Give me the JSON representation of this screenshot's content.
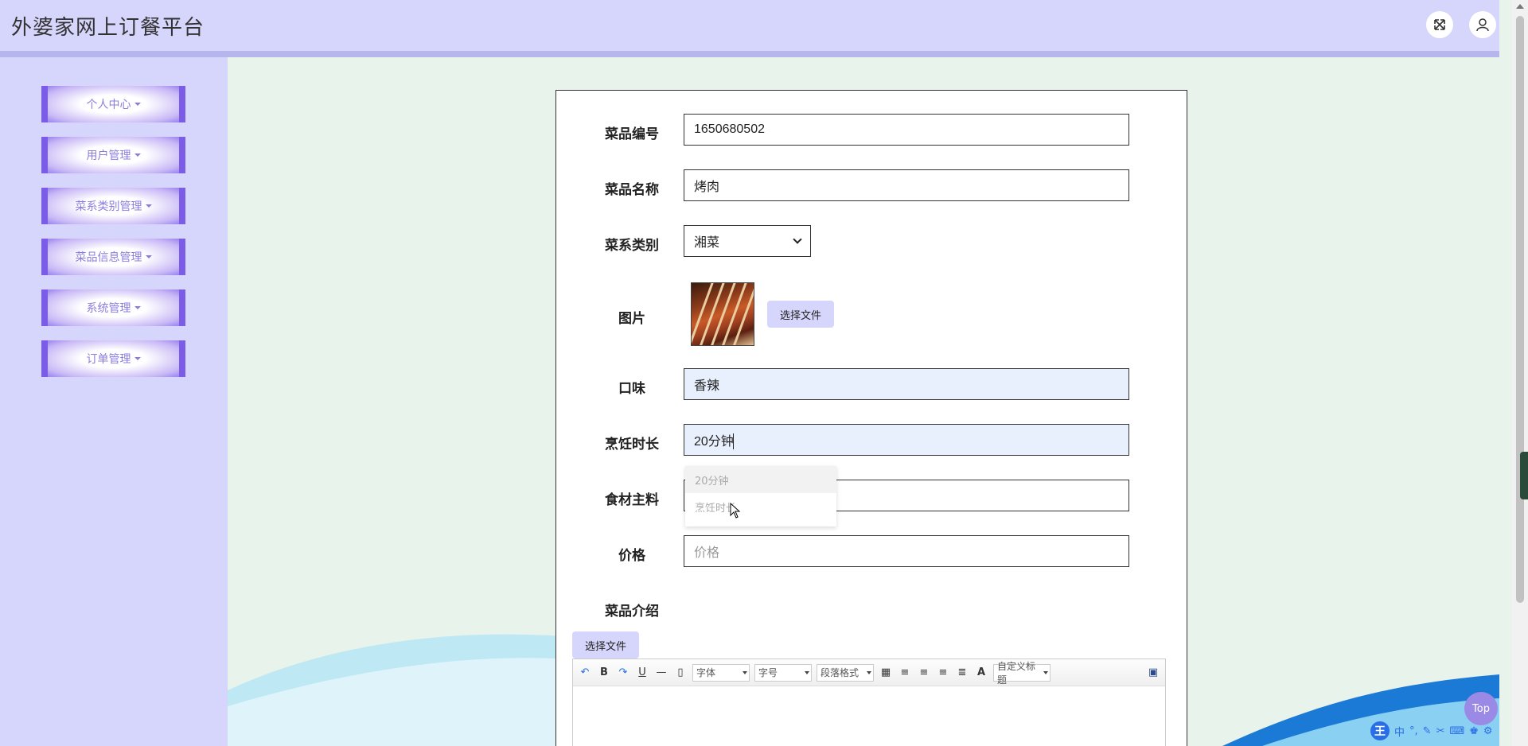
{
  "app": {
    "title": "外婆家网上订餐平台"
  },
  "header": {
    "fullscreen_icon": "expand-icon",
    "user_icon": "user-icon"
  },
  "sidebar": {
    "items": [
      {
        "label": "个人中心"
      },
      {
        "label": "用户管理"
      },
      {
        "label": "菜系类别管理"
      },
      {
        "label": "菜品信息管理"
      },
      {
        "label": "系统管理"
      },
      {
        "label": "订单管理"
      }
    ]
  },
  "form": {
    "dish_no": {
      "label": "菜品编号",
      "value": "1650680502"
    },
    "dish_name": {
      "label": "菜品名称",
      "value": "烤肉"
    },
    "cuisine": {
      "label": "菜系类别",
      "selected": "湘菜"
    },
    "image": {
      "label": "图片",
      "button": "选择文件"
    },
    "taste": {
      "label": "口味",
      "value": "香辣"
    },
    "cook_time": {
      "label": "烹饪时长",
      "value": "20分钟"
    },
    "ingredients": {
      "label": "食材主料",
      "placeholder": "食材主料"
    },
    "price": {
      "label": "价格",
      "placeholder": "价格"
    },
    "intro": {
      "label": "菜品介绍",
      "button": "选择文件"
    }
  },
  "autocomplete": {
    "items": [
      "20分钟",
      "烹饪时长"
    ]
  },
  "editor": {
    "font_family": "字体",
    "font_size": "字号",
    "paragraph": "段落格式",
    "custom_title": "自定义标题"
  },
  "top_button": "Top",
  "ime": {
    "logo": "王",
    "mode": "中"
  }
}
